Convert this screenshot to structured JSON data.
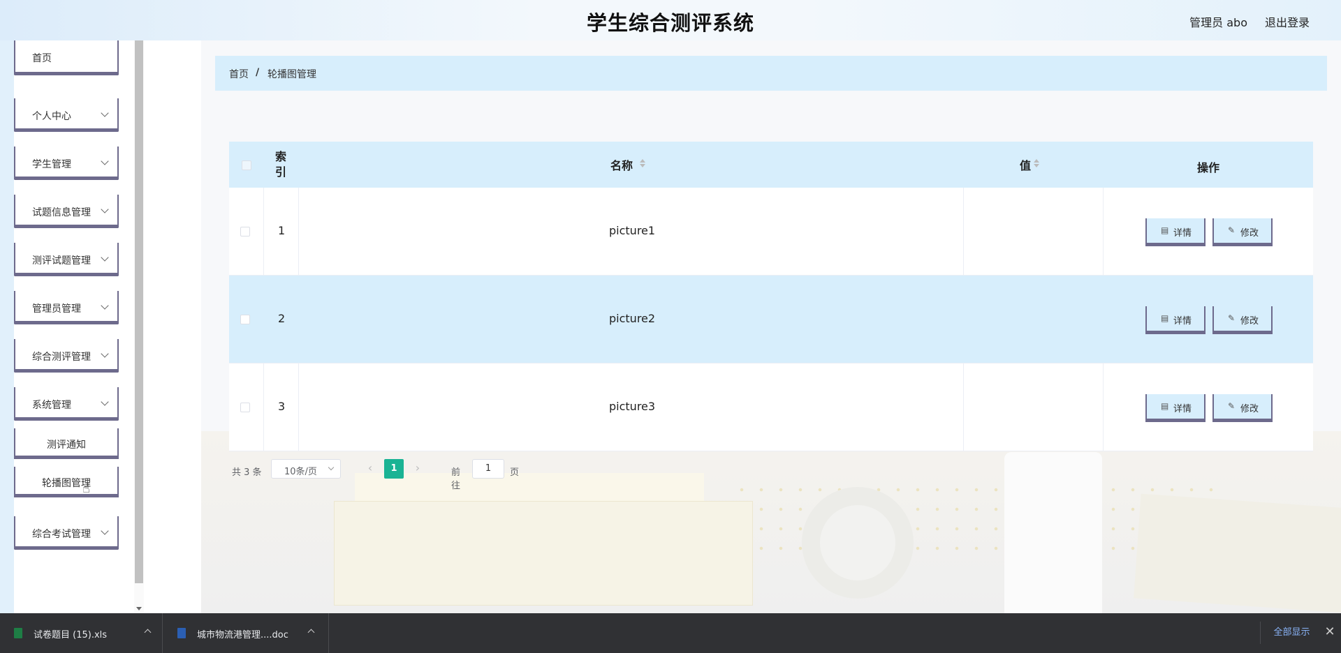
{
  "header": {
    "title": "学生综合测评系统",
    "user": "管理员 abo",
    "logout": "退出登录"
  },
  "sidebar": {
    "items": [
      {
        "label": "首页",
        "has_arrow": false
      },
      {
        "label": "个人中心",
        "has_arrow": true
      },
      {
        "label": "学生管理",
        "has_arrow": true
      },
      {
        "label": "试题信息管理",
        "has_arrow": true
      },
      {
        "label": "测评试题管理",
        "has_arrow": true
      },
      {
        "label": "管理员管理",
        "has_arrow": true
      },
      {
        "label": "综合测评管理",
        "has_arrow": true
      },
      {
        "label": "系统管理",
        "has_arrow": true
      }
    ],
    "sub_items": [
      {
        "label": "测评通知"
      },
      {
        "label": "轮播图管理"
      }
    ],
    "last_item": {
      "label": "综合考试管理",
      "has_arrow": true
    }
  },
  "breadcrumb": {
    "home": "首页",
    "separator": "/",
    "current": "轮播图管理"
  },
  "table": {
    "headers": {
      "index": "索\n引",
      "name": "名称",
      "value": "值",
      "actions": "操作"
    },
    "rows": [
      {
        "index": "1",
        "name": "picture1",
        "value": ""
      },
      {
        "index": "2",
        "name": "picture2",
        "value": ""
      },
      {
        "index": "3",
        "name": "picture3",
        "value": ""
      }
    ],
    "detail_label": "详情",
    "edit_label": "修改"
  },
  "pagination": {
    "total": "共 3 条",
    "page_size": "10条/页",
    "current_page": "1",
    "goto_label": "前往",
    "goto_value": "1",
    "page_unit": "页"
  },
  "downloads": {
    "items": [
      {
        "name": "试卷题目 (15).xls",
        "icon": "excel-file-icon"
      },
      {
        "name": "城市物流港管理....doc",
        "icon": "word-file-icon"
      }
    ],
    "show_all": "全部显示",
    "close_icon": "close-icon"
  },
  "colors": {
    "accent": "#1ab394",
    "panel": "#d7eefc",
    "border": "#6d6a8c"
  }
}
